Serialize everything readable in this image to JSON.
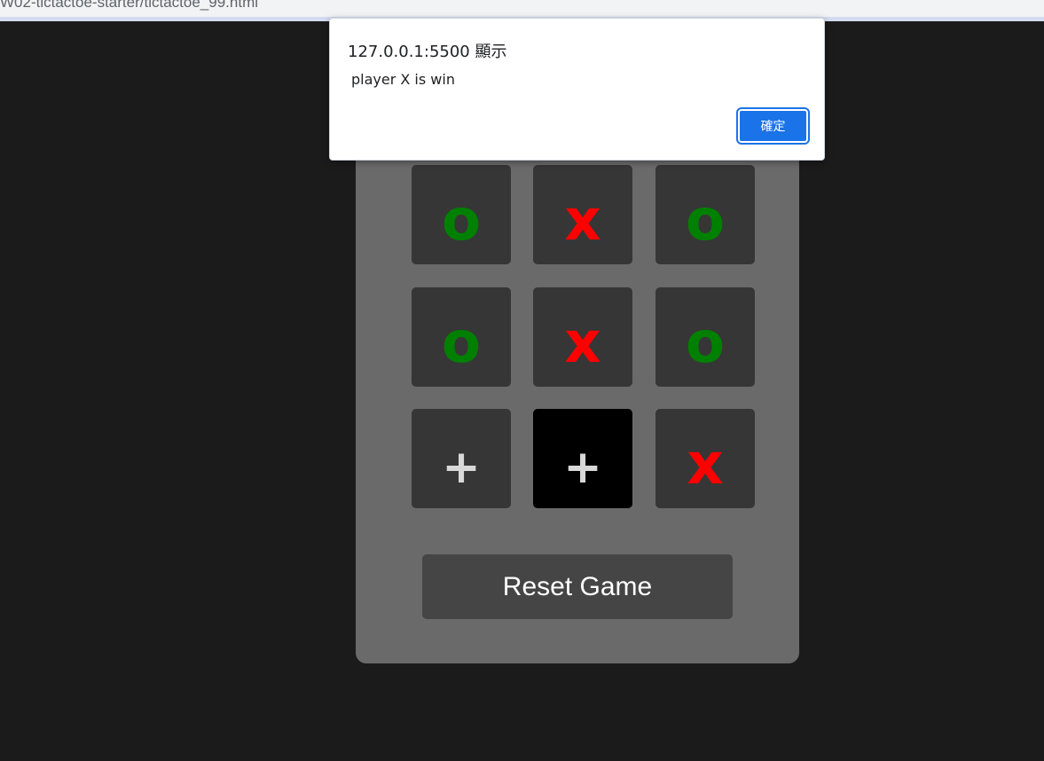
{
  "browser": {
    "url_fragment": "W02-tictactoe-starter/tictactoe_99.html"
  },
  "board": {
    "cells": [
      {
        "mark": "o",
        "text": "o"
      },
      {
        "mark": "x",
        "text": "x"
      },
      {
        "mark": "o",
        "text": "o"
      },
      {
        "mark": "o",
        "text": "o"
      },
      {
        "mark": "x",
        "text": "x"
      },
      {
        "mark": "o",
        "text": "o"
      },
      {
        "mark": "empty",
        "text": "+"
      },
      {
        "mark": "empty",
        "text": "+"
      },
      {
        "mark": "x",
        "text": "x"
      }
    ],
    "colors": {
      "x": "#ff0000",
      "o": "#008000",
      "empty": "#d8d8d8",
      "cell_bg": "#363636",
      "cell_hover_bg": "#000000",
      "panel_bg": "#6a6a6a",
      "page_bg": "#1b1b1b"
    }
  },
  "reset_button": {
    "label": "Reset Game"
  },
  "alert_dialog": {
    "title": "127.0.0.1:5500 顯示",
    "message": "player X is win",
    "ok_label": "確定",
    "accent_color": "#1a73e8"
  }
}
